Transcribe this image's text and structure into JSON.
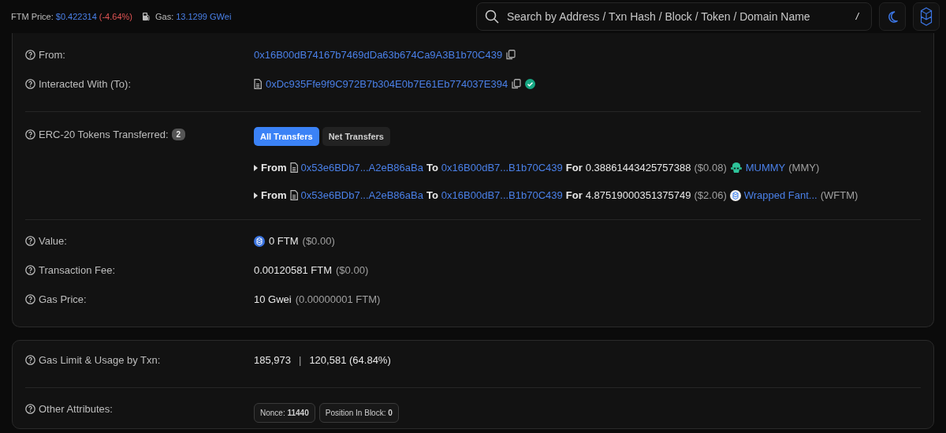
{
  "header": {
    "price_label": "FTM Price:",
    "price": "$0.422314",
    "change": "(-4.64%)",
    "gas_label": "Gas:",
    "gas": "13.1299 GWei",
    "search": {
      "placeholder": "Search by Address / Txn Hash / Block / Token / Domain Name",
      "shortcut": "/"
    }
  },
  "from": {
    "label": "From:",
    "address": "0x16B00dB74167b7469dDa63b674Ca9A3B1b70C439"
  },
  "to": {
    "label": "Interacted With (To):",
    "address": "0xDc935Ffe9f9C972B7b304E0b7E61Eb774037E394",
    "verified": true
  },
  "tokens": {
    "label": "ERC-20 Tokens Transferred:",
    "count": "2",
    "tabs": [
      {
        "label": "All Transfers",
        "selected": true
      },
      {
        "label": "Net Transfers",
        "selected": false
      }
    ],
    "transfers": [
      {
        "from_word": "From",
        "from": "0x53e6BDb7...A2eB86aBa",
        "to_word": "To",
        "to": "0x16B00dB7...B1b70C439",
        "for_word": "For",
        "amount": "0.38861443425757388",
        "usd": "($0.08)",
        "kind": "mascot",
        "token": "MUMMY",
        "symbol": "(MMY)"
      },
      {
        "from_word": "From",
        "from": "0x53e6BDb7...A2eB86aBa",
        "to_word": "To",
        "to": "0x16B00dB7...B1b70C439",
        "for_word": "For",
        "amount": "4.87519000351375749",
        "usd": "($2.06)",
        "kind": "coin",
        "token": "Wrapped Fant...",
        "symbol": "(WFTM)"
      }
    ]
  },
  "value": {
    "label": "Value:",
    "amount": "0 FTM",
    "usd": "($0.00)"
  },
  "fee": {
    "label": "Transaction Fee:",
    "amount": "0.00120581 FTM",
    "usd": "($0.00)"
  },
  "gas_price": {
    "label": "Gas Price:",
    "amount": "10 Gwei",
    "detail": "(0.00000001 FTM)"
  },
  "gas_limit": {
    "label": "Gas Limit & Usage by Txn:",
    "limit": "185,973",
    "separator": "|",
    "used": "120,581 (64.84%)"
  },
  "attributes": {
    "label": "Other Attributes:",
    "badges": [
      {
        "label": "Nonce:",
        "value": "11440"
      },
      {
        "label": "Position In Block:",
        "value": "0"
      }
    ]
  }
}
